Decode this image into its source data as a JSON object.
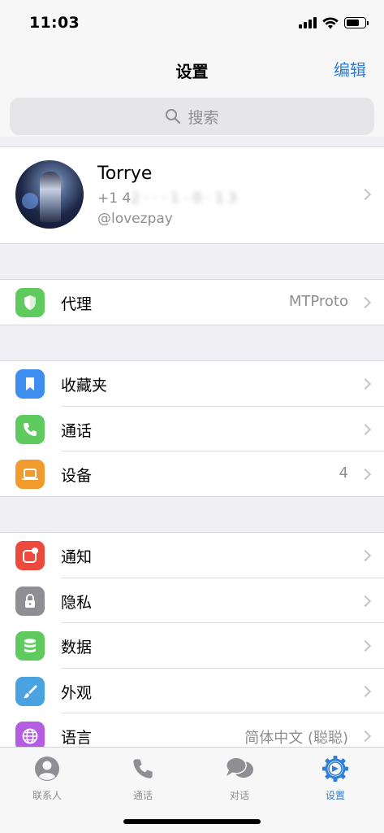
{
  "status": {
    "time": "11:03"
  },
  "nav": {
    "title": "设置",
    "edit_label": "编辑"
  },
  "search": {
    "placeholder": "搜索"
  },
  "profile": {
    "name": "Torrye",
    "phone_visible": "+1 4",
    "phone_blurred": "2  ·  · · 1 - 0 · 1 3",
    "username": "@lovezpay"
  },
  "sections": {
    "proxy": [
      {
        "label": "代理",
        "value": "MTProto",
        "icon": "shield-icon",
        "color": "#5fcb5f"
      }
    ],
    "main": [
      {
        "label": "收藏夹",
        "value": "",
        "icon": "bookmark-icon",
        "color": "#3e8ef0"
      },
      {
        "label": "通话",
        "value": "",
        "icon": "phone-icon",
        "color": "#5fcb5f"
      },
      {
        "label": "设备",
        "value": "4",
        "icon": "laptop-icon",
        "color": "#f19a2e"
      }
    ],
    "settings": [
      {
        "label": "通知",
        "value": "",
        "icon": "notification-icon",
        "color": "#ec4a3c"
      },
      {
        "label": "隐私",
        "value": "",
        "icon": "lock-icon",
        "color": "#8e8e93"
      },
      {
        "label": "数据",
        "value": "",
        "icon": "database-icon",
        "color": "#5fcb5f"
      },
      {
        "label": "外观",
        "value": "",
        "icon": "brush-icon",
        "color": "#4aa3e0"
      },
      {
        "label": "语言",
        "value": "简体中文 (聪聪)",
        "icon": "globe-icon",
        "color": "#b45de0"
      }
    ]
  },
  "tabs": [
    {
      "label": "联系人",
      "icon": "contacts-icon",
      "active": false
    },
    {
      "label": "通话",
      "icon": "calls-icon",
      "active": false
    },
    {
      "label": "对话",
      "icon": "chats-icon",
      "active": false
    },
    {
      "label": "设置",
      "icon": "settings-icon",
      "active": true
    }
  ],
  "colors": {
    "accent": "#2f7fd6",
    "inactive": "#8e8e93"
  }
}
